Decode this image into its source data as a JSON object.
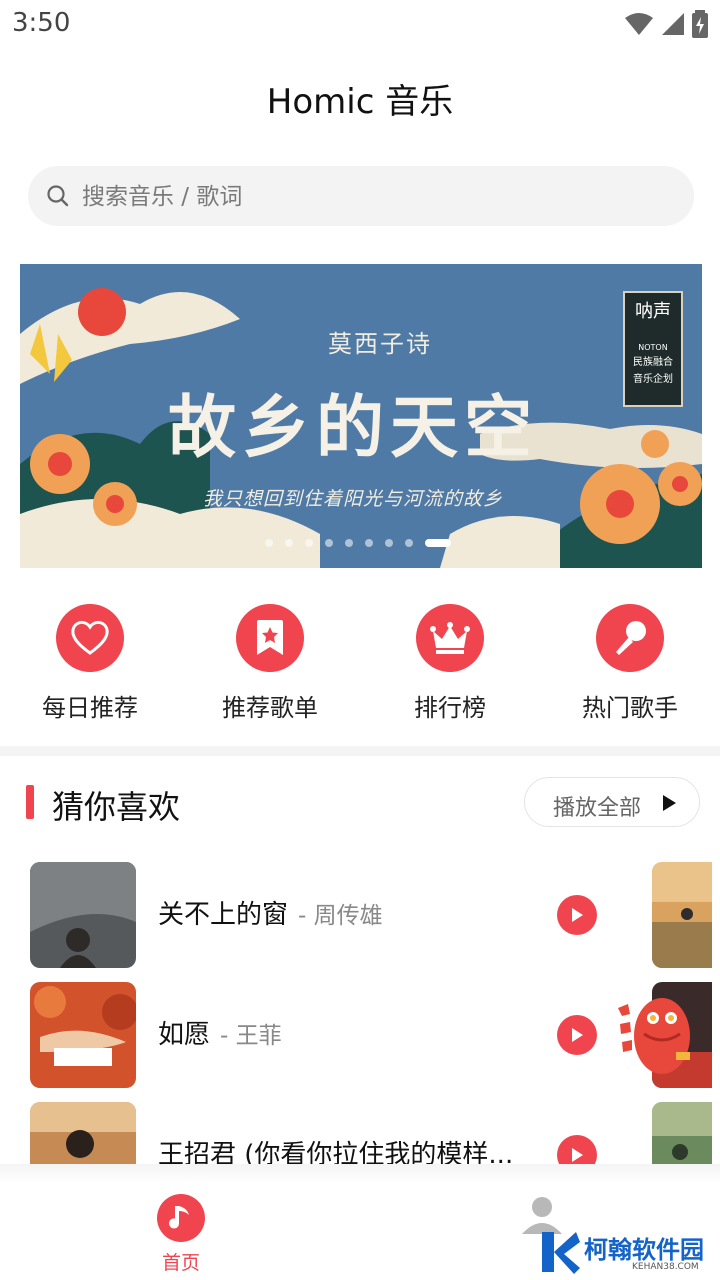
{
  "status_bar": {
    "time": "3:50"
  },
  "app": {
    "title": "Homic 音乐"
  },
  "search": {
    "placeholder": "搜索音乐 / 歌词"
  },
  "banner": {
    "subtitle": "莫西子诗",
    "title": "故乡的天空",
    "tagline": "我只想回到住着阳光与河流的故乡",
    "badge_title": "呐声",
    "badge_logo": "NOTON",
    "badge_line1": "民族融合",
    "badge_line2": "音乐企划",
    "dot_count": 9,
    "active_dot": 9
  },
  "quick_nav": [
    {
      "label": "每日推荐",
      "icon": "heart-icon"
    },
    {
      "label": "推荐歌单",
      "icon": "bookmark-star-icon"
    },
    {
      "label": "排行榜",
      "icon": "crown-icon"
    },
    {
      "label": "热门歌手",
      "icon": "microphone-icon"
    }
  ],
  "section": {
    "title": "猜你喜欢",
    "play_all": "播放全部"
  },
  "songs": [
    {
      "title": "关不上的窗",
      "artist": "- 周传雄"
    },
    {
      "title": "如愿",
      "artist": "- 王菲"
    },
    {
      "title": "王招君 (你看你拉住我的模样...",
      "artist": ""
    }
  ],
  "tabs": {
    "home": "首页"
  },
  "watermark": {
    "text": "柯翰软件园",
    "sub": "KEHAN38.COM"
  },
  "colors": {
    "accent": "#f0454f"
  }
}
